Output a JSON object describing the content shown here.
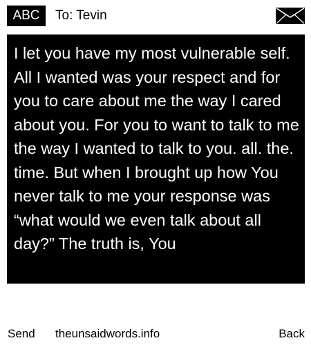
{
  "header": {
    "badge_label": "ABC",
    "to_text": "To: Tevin",
    "envelope_icon": "envelope-icon"
  },
  "message": {
    "body": "I let you have my most vulnerable self. All I wanted was your respect and for you to care about me the way I cared about you. For you to want to talk to me the way I wanted to talk to you. all. the. time. But when I brought up how You never talk to me your response was “what would we even talk about all day?” The truth is, You"
  },
  "footer": {
    "send_label": "Send",
    "site_label": "theunsaidwords.info",
    "back_label": "Back"
  },
  "colors": {
    "background": "#ffffff",
    "message_background": "#000000",
    "message_text": "#ffffff"
  }
}
